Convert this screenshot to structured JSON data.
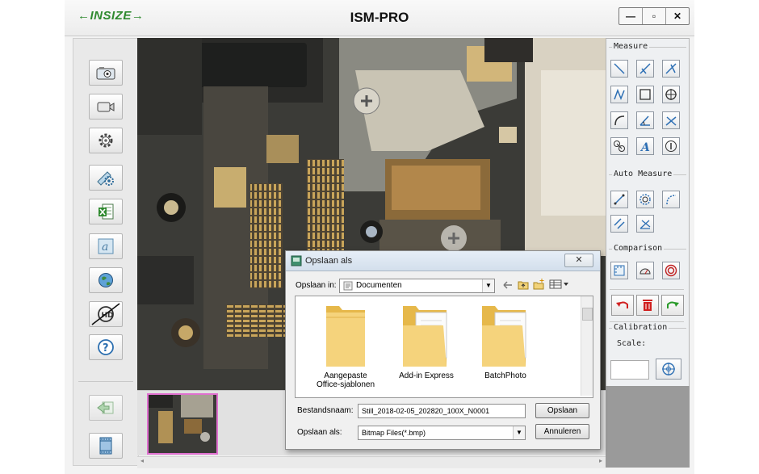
{
  "app": {
    "logo": "←INSIZE→",
    "title": "ISM-PRO",
    "window_controls": [
      "—",
      "▫",
      "✕"
    ]
  },
  "left_toolbar": {
    "icons": [
      "camera-icon",
      "video-camera-icon",
      "settings-gear-icon",
      "calibration-icon",
      "excel-export-icon",
      "text-annotation-icon",
      "globe-icon",
      "no-hd-icon",
      "help-icon"
    ],
    "help_glyph": "?"
  },
  "right_panel": {
    "measure_label": "Measure",
    "auto_measure_label": "Auto Measure",
    "comparison_label": "Comparison",
    "calibration_label": "Calibration",
    "scale_label": "Scale:",
    "scale_value": ""
  },
  "dialog": {
    "title": "Opslaan als",
    "close": "✕",
    "save_in_label": "Opslaan in:",
    "save_in_value": "Documenten",
    "folders": [
      {
        "name_line1": "Aangepaste",
        "name_line2": "Office-sjablonen"
      },
      {
        "name_line1": "Add-in Express",
        "name_line2": ""
      },
      {
        "name_line1": "BatchPhoto",
        "name_line2": ""
      }
    ],
    "filename_label": "Bestandsnaam:",
    "filename_value": "Still_2018-02-05_202820_100X_N0001",
    "filetype_label": "Opslaan als:",
    "filetype_value": "Bitmap Files(*.bmp)",
    "save_button": "Opslaan",
    "cancel_button": "Annuleren"
  },
  "colors": {
    "logo_green": "#2f8a2f",
    "undo_red": "#d02020",
    "redo_green": "#2a9a2a",
    "thumb_border": "#e070d0"
  }
}
